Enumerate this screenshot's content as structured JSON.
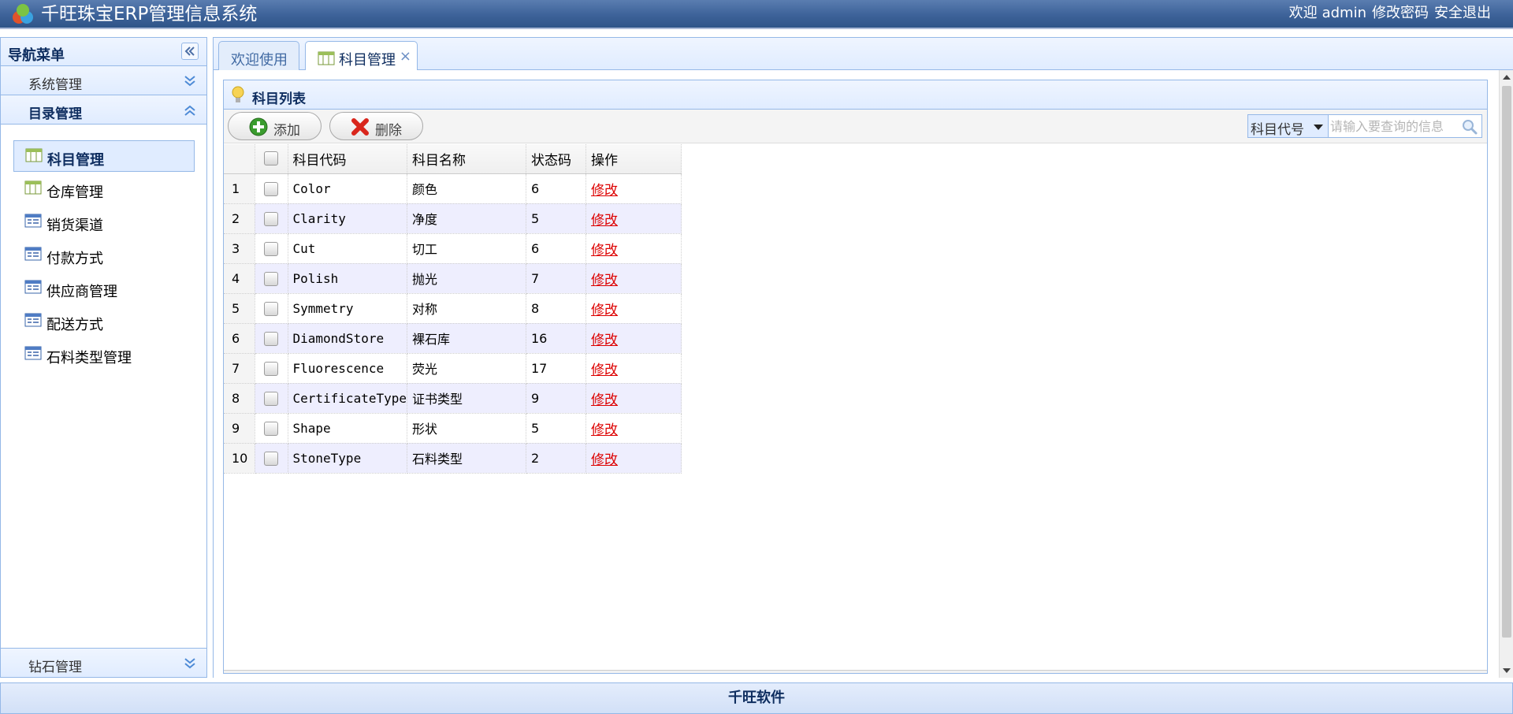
{
  "header": {
    "title": "千旺珠宝ERP管理信息系统",
    "welcome": "欢迎",
    "user": "admin",
    "change_password": "修改密码",
    "logout": "安全退出"
  },
  "nav": {
    "title": "导航菜单",
    "sections": [
      {
        "label": "系统管理",
        "expanded": false
      },
      {
        "label": "目录管理",
        "expanded": true
      },
      {
        "label": "钻石管理",
        "expanded": false
      }
    ],
    "items": [
      {
        "label": "科目管理",
        "icon": "grid-icon",
        "selected": true
      },
      {
        "label": "仓库管理",
        "icon": "grid-icon"
      },
      {
        "label": "销货渠道",
        "icon": "list-icon"
      },
      {
        "label": "付款方式",
        "icon": "list-icon"
      },
      {
        "label": "供应商管理",
        "icon": "list-icon"
      },
      {
        "label": "配送方式",
        "icon": "list-icon"
      },
      {
        "label": "石料类型管理",
        "icon": "list-icon"
      }
    ]
  },
  "tabs": [
    {
      "label": "欢迎使用",
      "active": false
    },
    {
      "label": "科目管理",
      "active": true,
      "close": "×"
    }
  ],
  "panel": {
    "title": "科目列表",
    "add_label": "添加",
    "delete_label": "删除",
    "search": {
      "field": "科目代号",
      "placeholder": "请输入要查询的信息"
    }
  },
  "grid": {
    "columns": [
      "科目代码",
      "科目名称",
      "状态码",
      "操作"
    ],
    "rows": [
      {
        "n": "1",
        "code": "Color",
        "name": "颜色",
        "status": "6",
        "action": "修改"
      },
      {
        "n": "2",
        "code": "Clarity",
        "name": "净度",
        "status": "5",
        "action": "修改"
      },
      {
        "n": "3",
        "code": "Cut",
        "name": "切工",
        "status": "6",
        "action": "修改"
      },
      {
        "n": "4",
        "code": "Polish",
        "name": "抛光",
        "status": "7",
        "action": "修改"
      },
      {
        "n": "5",
        "code": "Symmetry",
        "name": "对称",
        "status": "8",
        "action": "修改"
      },
      {
        "n": "6",
        "code": "DiamondStore",
        "name": "裸石库",
        "status": "16",
        "action": "修改"
      },
      {
        "n": "7",
        "code": "Fluorescence",
        "name": "荧光",
        "status": "17",
        "action": "修改"
      },
      {
        "n": "8",
        "code": "CertificateType",
        "name": "证书类型",
        "status": "9",
        "action": "修改"
      },
      {
        "n": "9",
        "code": "Shape",
        "name": "形状",
        "status": "5",
        "action": "修改"
      },
      {
        "n": "10",
        "code": "StoneType",
        "name": "石料类型",
        "status": "2",
        "action": "修改"
      }
    ]
  },
  "footer": {
    "text": "千旺软件"
  }
}
